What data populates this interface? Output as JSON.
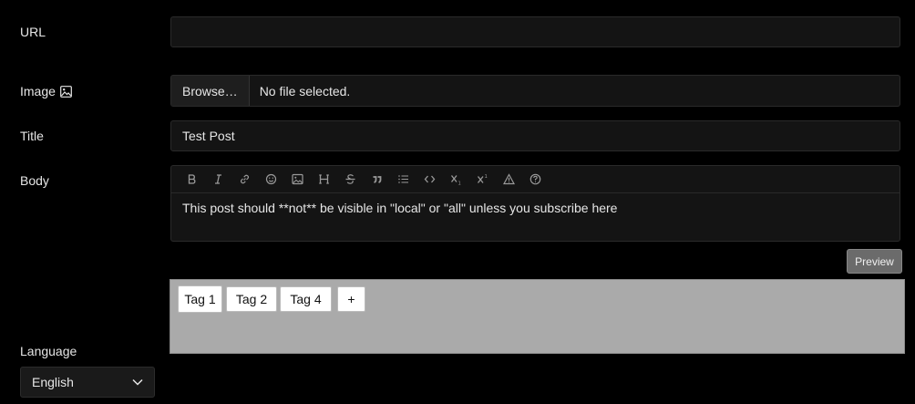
{
  "labels": {
    "url": "URL",
    "image": "Image",
    "title": "Title",
    "body": "Body",
    "language": "Language"
  },
  "fields": {
    "url_value": "",
    "browse_label": "Browse…",
    "file_status": "No file selected.",
    "title_value": "Test Post",
    "body_value": "This post should **not** be visible in \"local\" or \"all\" unless you subscribe here"
  },
  "toolbar": [
    "bold-icon",
    "italic-icon",
    "link-icon",
    "emoji-icon",
    "image-icon",
    "header-icon",
    "strikethrough-icon",
    "quote-icon",
    "list-icon",
    "code-icon",
    "subscript-icon",
    "superscript-icon",
    "spoiler-warning-icon",
    "help-icon"
  ],
  "preview_label": "Preview",
  "tags": [
    "Tag 1",
    "Tag 2",
    "Tag 4"
  ],
  "add_tag_label": "+",
  "language_value": "English",
  "colors": {
    "background": "#000000",
    "field_bg": "#141414",
    "preview_bg": "#6b6b6b",
    "tags_bg": "#aaaaaa"
  }
}
